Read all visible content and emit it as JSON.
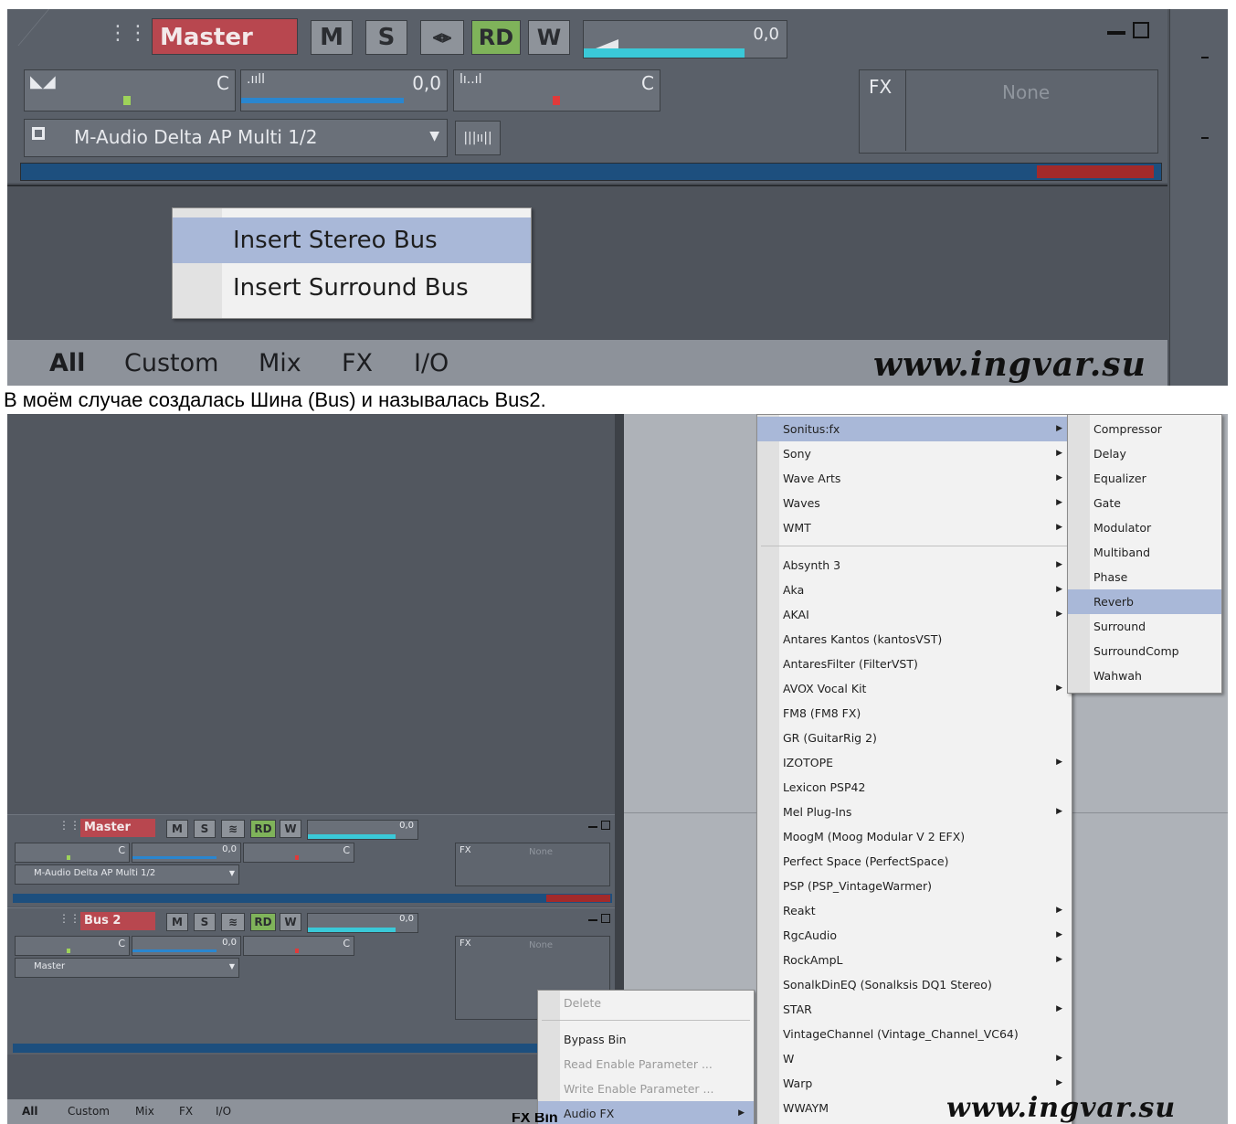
{
  "top": {
    "track_name": "Master",
    "buttons": {
      "mute": "M",
      "solo": "S",
      "read": "RD",
      "write": "W"
    },
    "volume_value": "0,0",
    "pan_value": "C",
    "gain_value": "0,0",
    "pan2_value": "C",
    "output_device": "M-Audio Delta AP Multi 1/2",
    "fx_label": "FX",
    "fx_value": "None",
    "context_menu": [
      "Insert Stereo Bus",
      "Insert Surround Bus"
    ],
    "tabs": [
      "All",
      "Custom",
      "Mix",
      "FX",
      "I/O"
    ],
    "watermark": "www.ingvar.su"
  },
  "caption_top": "В моём случае создалась Шина (Bus) и называлась Bus2.",
  "bottom": {
    "tracks": [
      {
        "name": "Master",
        "output": "M-Audio Delta AP Multi 1/2",
        "fx": "None",
        "vol": "0,0",
        "gain": "0,0",
        "pan": "C"
      },
      {
        "name": "Bus 2",
        "output": "Master",
        "fx": "None",
        "vol": "0,0",
        "gain": "0,0",
        "pan": "C"
      }
    ],
    "buttons": {
      "mute": "M",
      "solo": "S",
      "read": "RD",
      "write": "W"
    },
    "fx_label": "FX",
    "fx_menu": [
      "Delete",
      "Bypass Bin",
      "Read Enable Parameter ...",
      "Write Enable Parameter ...",
      "Audio FX"
    ],
    "plugin_menu": {
      "group1": [
        "Sonitus:fx",
        "Sony",
        "Wave Arts",
        "Waves",
        "WMT"
      ],
      "group2": [
        "Absynth 3",
        "Aka",
        "AKAI",
        "Antares Kantos (kantosVST)",
        "AntaresFilter (FilterVST)",
        "AVOX Vocal Kit",
        "FM8 (FM8 FX)",
        "GR (GuitarRig 2)",
        "IZOTOPE",
        "Lexicon PSP42",
        "Mel Plug-Ins",
        "MoogM (Moog Modular V 2 EFX)",
        "Perfect Space (PerfectSpace)",
        "PSP (PSP_VintageWarmer)",
        "Reakt",
        "RgcAudio",
        "RockAmpL",
        "SonalkDinEQ (Sonalksis DQ1 Stereo)",
        "STAR",
        "VintageChannel (Vintage_Channel_VC64)",
        "W",
        "Warp",
        "WWAYM"
      ]
    },
    "sonitus_menu": [
      "Compressor",
      "Delay",
      "Equalizer",
      "Gate",
      "Modulator",
      "Multiband",
      "Phase",
      "Reverb",
      "Surround",
      "SurroundComp",
      "Wahwah"
    ],
    "tabs": [
      "All",
      "Custom",
      "Mix",
      "FX",
      "I/O"
    ],
    "watermark": "www.ingvar.su"
  },
  "caption_bottom": "FX Bin"
}
